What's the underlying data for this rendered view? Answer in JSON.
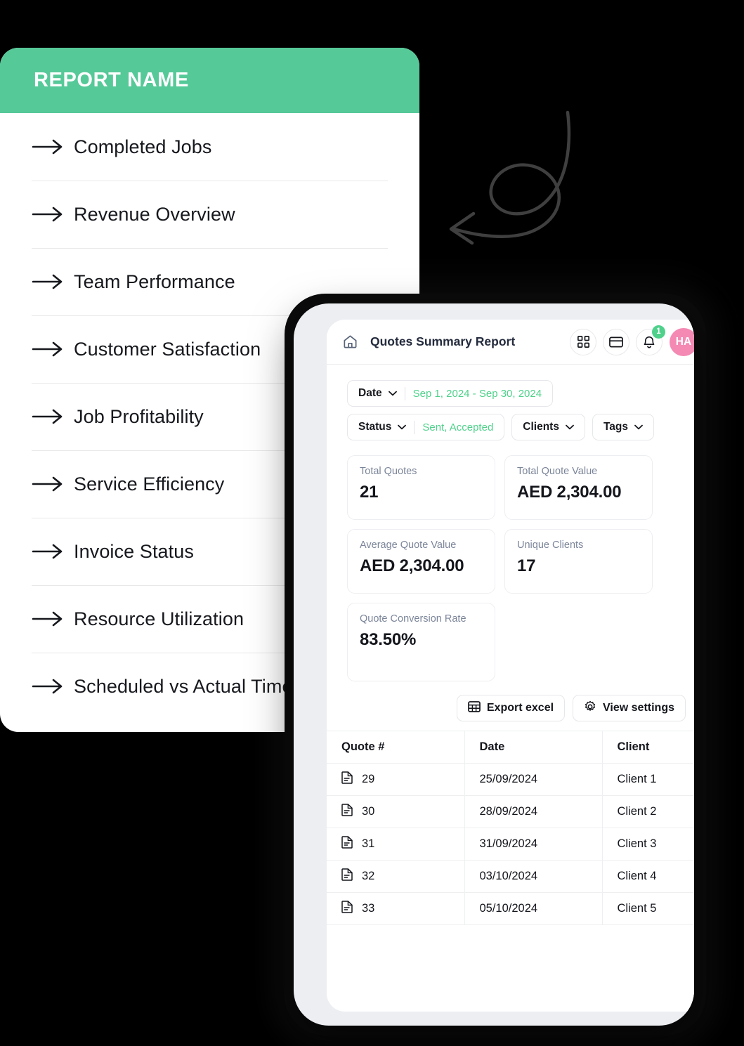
{
  "colors": {
    "green_header": "#56c999",
    "accent_green": "#4fd18b",
    "avatar_pink": "#f489b4",
    "stat_label_gray": "#7b8599",
    "text_dark": "#14161c"
  },
  "report_card": {
    "header_title": "REPORT NAME",
    "items": [
      {
        "icon": "arrow-right-icon",
        "label": "Completed Jobs"
      },
      {
        "icon": "arrow-right-icon",
        "label": "Revenue Overview"
      },
      {
        "icon": "arrow-right-icon",
        "label": "Team Performance"
      },
      {
        "icon": "arrow-right-icon",
        "label": "Customer Satisfaction"
      },
      {
        "icon": "arrow-right-icon",
        "label": "Job Profitability"
      },
      {
        "icon": "arrow-right-icon",
        "label": "Service Efficiency"
      },
      {
        "icon": "arrow-right-icon",
        "label": "Invoice Status"
      },
      {
        "icon": "arrow-right-icon",
        "label": "Resource Utilization"
      },
      {
        "icon": "arrow-right-icon",
        "label": "Scheduled vs Actual Time"
      }
    ]
  },
  "decoration": {
    "arrow": "curved-loop-arrow-left-icon"
  },
  "phone": {
    "app_bar": {
      "home_icon": "home-icon",
      "title": "Quotes Summary Report",
      "grid_icon": "grid-apps-icon",
      "card_icon": "credit-card-icon",
      "bell_icon": "bell-icon",
      "notification_count": "1",
      "avatar_initials": "HA"
    },
    "filters": [
      {
        "label": "Date",
        "value": "Sep 1, 2024 - Sep 30, 2024",
        "chevron": "chevron-down-icon"
      },
      {
        "label": "Status",
        "value": "Sent, Accepted",
        "chevron": "chevron-down-icon"
      },
      {
        "label": "Clients",
        "value": "",
        "chevron": "chevron-down-icon"
      },
      {
        "label": "Tags",
        "value": "",
        "chevron": "chevron-down-icon"
      }
    ],
    "stats": [
      {
        "label": "Total Quotes",
        "value": "21"
      },
      {
        "label": "Total Quote Value",
        "value": "AED 2,304.00"
      },
      {
        "label": "Average Quote Value",
        "value": "AED 2,304.00"
      },
      {
        "label": "Unique Clients",
        "value": "17"
      },
      {
        "label": "Quote Conversion Rate",
        "value": "83.50%"
      }
    ],
    "actions": [
      {
        "label": "Export excel",
        "icon": "table-grid-icon"
      },
      {
        "label": "View settings",
        "icon": "gear-icon"
      }
    ],
    "table": {
      "columns": [
        "Quote #",
        "Date",
        "Client"
      ],
      "rows": [
        {
          "icon": "document-icon",
          "quote": "29",
          "date": "25/09/2024",
          "client": "Client 1"
        },
        {
          "icon": "document-icon",
          "quote": "30",
          "date": "28/09/2024",
          "client": "Client 2"
        },
        {
          "icon": "document-icon",
          "quote": "31",
          "date": "31/09/2024",
          "client": "Client 3"
        },
        {
          "icon": "document-icon",
          "quote": "32",
          "date": "03/10/2024",
          "client": "Client 4"
        },
        {
          "icon": "document-icon",
          "quote": "33",
          "date": "05/10/2024",
          "client": "Client 5"
        }
      ]
    }
  }
}
